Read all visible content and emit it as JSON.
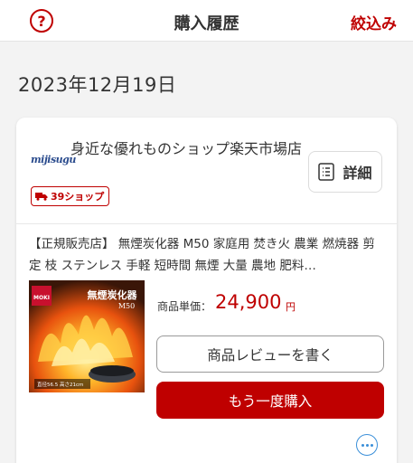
{
  "header": {
    "help_icon": "question-circle-icon",
    "help_glyph": "?",
    "title": "購入履歴",
    "filter_label": "絞込み"
  },
  "order": {
    "date": "2023年12月19日",
    "shop": {
      "logo_text": "mijisugu",
      "name": "身近な優れものショップ楽天市場店",
      "badge_label": "39ショップ",
      "badge_icon": "truck-icon"
    },
    "detail_button": {
      "label": "詳細",
      "icon": "list-document-icon"
    },
    "product": {
      "title": "【正規販売店】 無煙炭化器 M50 家庭用 焚き火 農業 燃焼器 剪定 枝 ステンレス 手軽 短時間 無煙 大量 農地 肥料…",
      "image_text": {
        "brand": "MOKI",
        "name": "無煙炭化器",
        "model": "M50",
        "spec": "直径56.5 高さ21cm"
      },
      "unit_price_label": "商品単価：",
      "unit_price": "24,900",
      "unit_price_suffix": "円"
    },
    "review_button_label": "商品レビューを書く",
    "rebuy_button_label": "もう一度購入",
    "more_icon": "more-dots-icon"
  },
  "colors": {
    "accent": "#bf0000",
    "link_blue": "#3a8fd9",
    "background": "#f3f3f3",
    "card": "#ffffff"
  }
}
